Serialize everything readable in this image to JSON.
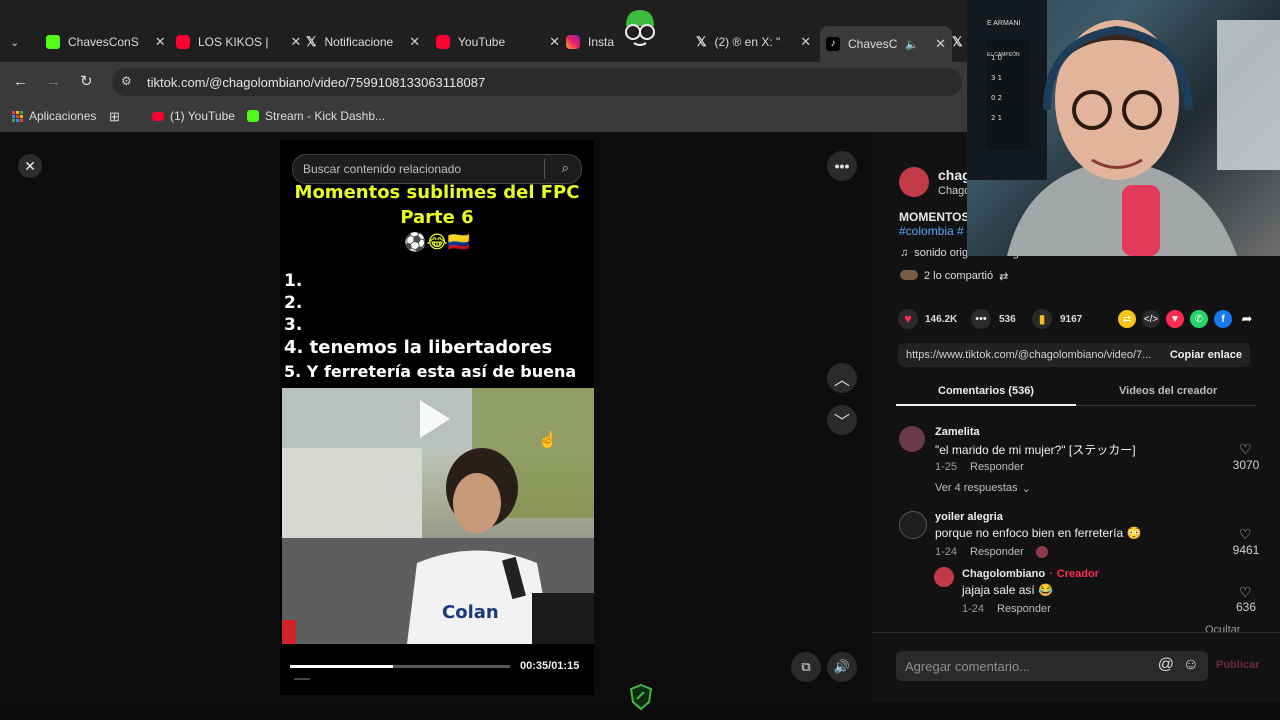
{
  "tabs": [
    {
      "label": "ChavesConS",
      "icon": "kick-icon",
      "active": false
    },
    {
      "label": "LOS KIKOS |",
      "icon": "youtube-icon",
      "active": false
    },
    {
      "label": "Notificacione",
      "icon": "x-icon",
      "active": false
    },
    {
      "label": "YouTube",
      "icon": "youtube-icon",
      "active": false
    },
    {
      "label": "Insta",
      "icon": "instagram-icon",
      "active": false
    },
    {
      "label": "(2) ® en X: \"",
      "icon": "x-icon",
      "active": false
    },
    {
      "label": "ChavesC",
      "icon": "tiktok-icon",
      "active": true
    }
  ],
  "address": {
    "url": "tiktok.com/@chagolombiano/video/7599108133063118087"
  },
  "bookmarks": [
    {
      "label": "Aplicaciones"
    },
    {
      "label": "(1) YouTube"
    },
    {
      "label": "Stream - Kick Dashb..."
    }
  ],
  "video": {
    "search_placeholder": "Buscar contenido relacionado",
    "title_line1": "Momentos sublimes del FPC",
    "title_line2": "Parte 6",
    "emoji": "⚽😂🇨🇴",
    "list": [
      "1.",
      "2.",
      "3.",
      "4. tenemos la libertadores",
      "5. Y ferretería esta así de buena"
    ],
    "progress": 0.47,
    "timecode": "00:35/01:15"
  },
  "author": {
    "name": "chag",
    "handle": "Chago",
    "desc": "MOMENTOS",
    "hashtags": "#colombia #",
    "sound": "sonido original - chagolombiano",
    "shared": "2 lo compartió"
  },
  "actions": {
    "likes": "146.2K",
    "comments": "536",
    "saves": "9167"
  },
  "link": {
    "url": "https://www.tiktok.com/@chagolombiano/video/7...",
    "copy_label": "Copiar enlace"
  },
  "panel_tabs": {
    "comments": "Comentarios (536)",
    "creator_videos": "Videos del creador"
  },
  "comments": [
    {
      "user": "Zamelita",
      "text": "\"el marido de mi mujer?\" [ステッカー]",
      "date": "1-25",
      "reply": "Responder",
      "likes": "3070",
      "view_replies": "Ver 4 respuestas"
    },
    {
      "user": "yoiler alegria",
      "text": "porque no enfoco bien en ferretería 😳",
      "date": "1-24",
      "reply": "Responder",
      "likes": "9461"
    },
    {
      "user": "Chagolombiano",
      "creator_tag": "Creador",
      "text": "jajaja sale así 😂",
      "date": "1-24",
      "reply": "Responder",
      "likes": "636"
    }
  ],
  "hide_label": "Ocultar",
  "comment_input": {
    "placeholder": "Agregar comentario...",
    "publish": "Publicar"
  },
  "webcam": {
    "badge": "E ARMANI",
    "board_title": "EL CAMPEÓN"
  },
  "colors": {
    "accent": "#fe2c55",
    "yellow_title": "#e9ff1f",
    "creator": "#fe2c55",
    "kick": "#53fc18"
  }
}
